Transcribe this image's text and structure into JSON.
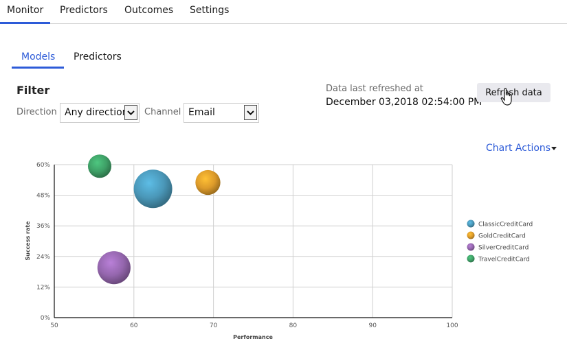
{
  "top_tabs": [
    {
      "label": "Monitor",
      "active": true
    },
    {
      "label": "Predictors",
      "active": false
    },
    {
      "label": "Outcomes",
      "active": false
    },
    {
      "label": "Settings",
      "active": false
    }
  ],
  "sub_tabs": [
    {
      "label": "Models",
      "active": true
    },
    {
      "label": "Predictors",
      "active": false
    }
  ],
  "filter": {
    "title": "Filter",
    "direction_label": "Direction",
    "direction_value": "Any direction",
    "channel_label": "Channel",
    "channel_value": "Email"
  },
  "refresh": {
    "label": "Data last refreshed at",
    "value": "December 03,2018 02:54:00 PM",
    "button_label": "Refresh data"
  },
  "chart_actions_label": "Chart Actions",
  "colors": {
    "accent": "#2d5bd8"
  },
  "chart_data": {
    "type": "scatter",
    "subtype": "bubble",
    "title": "",
    "xlabel": "Performance",
    "ylabel": "Success rate",
    "xlim": [
      50,
      100
    ],
    "ylim": [
      0,
      60
    ],
    "x_ticks": [
      "50",
      "60",
      "70",
      "80",
      "90",
      "100"
    ],
    "y_ticks": [
      "0%",
      "12%",
      "24%",
      "36%",
      "48%",
      "60%"
    ],
    "grid": true,
    "legend_position": "right",
    "series": [
      {
        "name": "ClassicCreditCard",
        "x": 62.4,
        "y": 50.5,
        "size": 1.0,
        "color": "#4a97b8"
      },
      {
        "name": "GoldCreditCard",
        "x": 69.3,
        "y": 53.0,
        "size": 0.42,
        "color": "#dc9a2a"
      },
      {
        "name": "SilverCreditCard",
        "x": 57.5,
        "y": 19.6,
        "size": 0.74,
        "color": "#9466ad"
      },
      {
        "name": "TravelCreditCard",
        "x": 55.7,
        "y": 59.4,
        "size": 0.37,
        "color": "#3e9f66"
      }
    ]
  }
}
